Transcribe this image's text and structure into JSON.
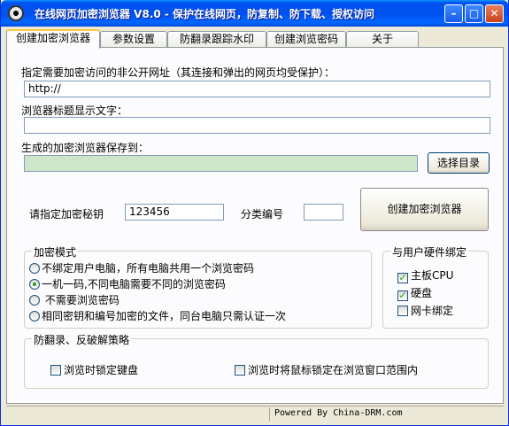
{
  "window": {
    "title": "在线网页加密浏览器 V8.0 -  保护在线网页，防复制、防下载、授权访问",
    "min_label": "–",
    "max_label": "□",
    "close_label": "✕"
  },
  "tabs": [
    {
      "label": "创建加密浏览器",
      "active": true
    },
    {
      "label": "参数设置"
    },
    {
      "label": "防翻录跟踪水印"
    },
    {
      "label": "创建浏览密码"
    },
    {
      "label": "关于"
    }
  ],
  "form": {
    "url_label": "指定需要加密访问的非公开网址（其连接和弹出的网页均受保护）：",
    "url_value": "http://",
    "browser_title_label": "浏览器标题显示文字：",
    "browser_title_value": "",
    "save_to_label": "生成的加密浏览器保存到：",
    "save_to_value": "",
    "choose_dir_button": "选择目录",
    "key_label": "请指定加密秘钥",
    "key_value": "123456",
    "category_label": "分类编号",
    "category_value": "",
    "create_button": "创建加密浏览器"
  },
  "encrypt_mode": {
    "title": "加密模式",
    "options": [
      {
        "label": "不绑定用户电脑，所有电脑共用一个浏览密码",
        "selected": false
      },
      {
        "label": "一机一码,不同电脑需要不同的浏览密码",
        "selected": true
      },
      {
        "label": " 不需要浏览密码",
        "selected": false
      },
      {
        "label": "相同密钥和编号加密的文件，同台电脑只需认证一次",
        "selected": false
      }
    ]
  },
  "hardware_binding": {
    "title": "与用户硬件绑定",
    "items": [
      {
        "label": "主板CPU",
        "checked": true
      },
      {
        "label": "硬盘",
        "checked": true
      },
      {
        "label": "网卡绑定",
        "checked": false
      }
    ]
  },
  "anti_record": {
    "title": "防翻录、反破解策略",
    "lock_keyboard": "浏览时锁定键盘",
    "lock_mouse": "浏览时将鼠标锁定在浏览窗口范围内"
  },
  "status": {
    "text": "Powered By China-DRM.com"
  },
  "colors": {
    "title_blue": "#0053ee",
    "panel_bg": "#fcfcfe",
    "save_field_green": "#cfe5c9",
    "check_green": "#21a121"
  }
}
